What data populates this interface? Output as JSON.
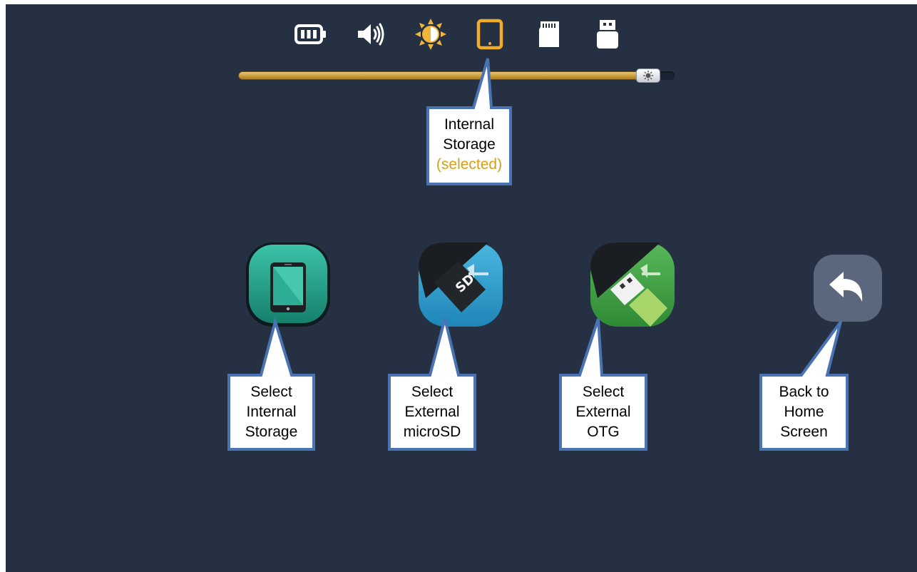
{
  "status_bar": {
    "icons": [
      {
        "name": "battery-icon",
        "selected": false
      },
      {
        "name": "volume-icon",
        "selected": false
      },
      {
        "name": "brightness-icon",
        "selected": false
      },
      {
        "name": "tablet-storage-icon",
        "selected": true
      },
      {
        "name": "microsd-card-icon",
        "selected": false
      },
      {
        "name": "usb-drive-icon",
        "selected": false
      }
    ]
  },
  "slider": {
    "level": 0.96,
    "thumb_icon": "brightness-icon"
  },
  "apps": [
    {
      "name": "internal-storage-app-icon",
      "color": "#1f9a84"
    },
    {
      "name": "external-microsd-app-icon",
      "color": "#2c98c9"
    },
    {
      "name": "external-otg-app-icon",
      "color": "#3a9a3e"
    },
    {
      "name": "back-home-app-icon",
      "color": "#56637a"
    }
  ],
  "callouts": {
    "internal_storage": {
      "line1": "Internal",
      "line2": "Storage",
      "line3": "(selected)"
    },
    "select_internal": {
      "line1": "Select",
      "line2": "Internal",
      "line3": "Storage"
    },
    "select_microsd": {
      "line1": "Select",
      "line2": "External",
      "line3": "microSD"
    },
    "select_otg": {
      "line1": "Select",
      "line2": "External",
      "line3": "OTG"
    },
    "back_home": {
      "line1": "Back to",
      "line2": "Home",
      "line3": "Screen"
    }
  },
  "colors": {
    "background": "#253042",
    "accent": "#f0ac2a",
    "callout_border": "#4a73b3",
    "selected_text": "#d4a017"
  }
}
